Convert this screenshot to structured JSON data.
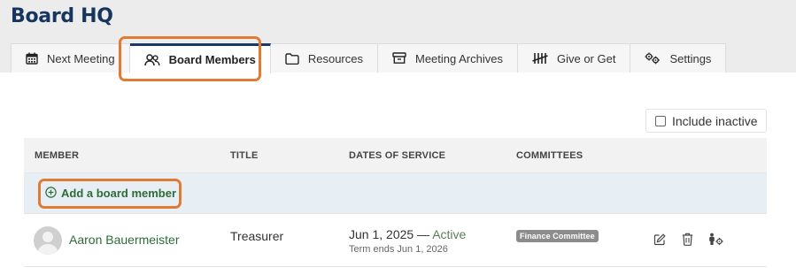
{
  "app": {
    "title": "Board HQ"
  },
  "tabs": [
    {
      "label": "Next Meeting",
      "icon": "calendar-icon"
    },
    {
      "label": "Board Members",
      "icon": "people-icon",
      "active": true
    },
    {
      "label": "Resources",
      "icon": "folder-icon"
    },
    {
      "label": "Meeting Archives",
      "icon": "archive-box-icon"
    },
    {
      "label": "Give or Get",
      "icon": "tally-icon"
    },
    {
      "label": "Settings",
      "icon": "gears-icon"
    }
  ],
  "filters": {
    "include_inactive_label": "Include inactive",
    "include_inactive_checked": false
  },
  "table": {
    "columns": [
      "MEMBER",
      "TITLE",
      "DATES OF SERVICE",
      "COMMITTEES"
    ],
    "add_label": "Add a board member",
    "rows": [
      {
        "name": "Aaron Bauermeister",
        "title": "Treasurer",
        "start": "Jun 1, 2025",
        "dash": "—",
        "status": "Active",
        "term": "Term ends Jun 1, 2026",
        "committees": [
          "Finance Committee"
        ]
      }
    ]
  },
  "colors": {
    "brand": "#16365f",
    "accent_highlight": "#e07b33",
    "link_green": "#2e6b37",
    "add_row_bg": "#e7eff5"
  }
}
